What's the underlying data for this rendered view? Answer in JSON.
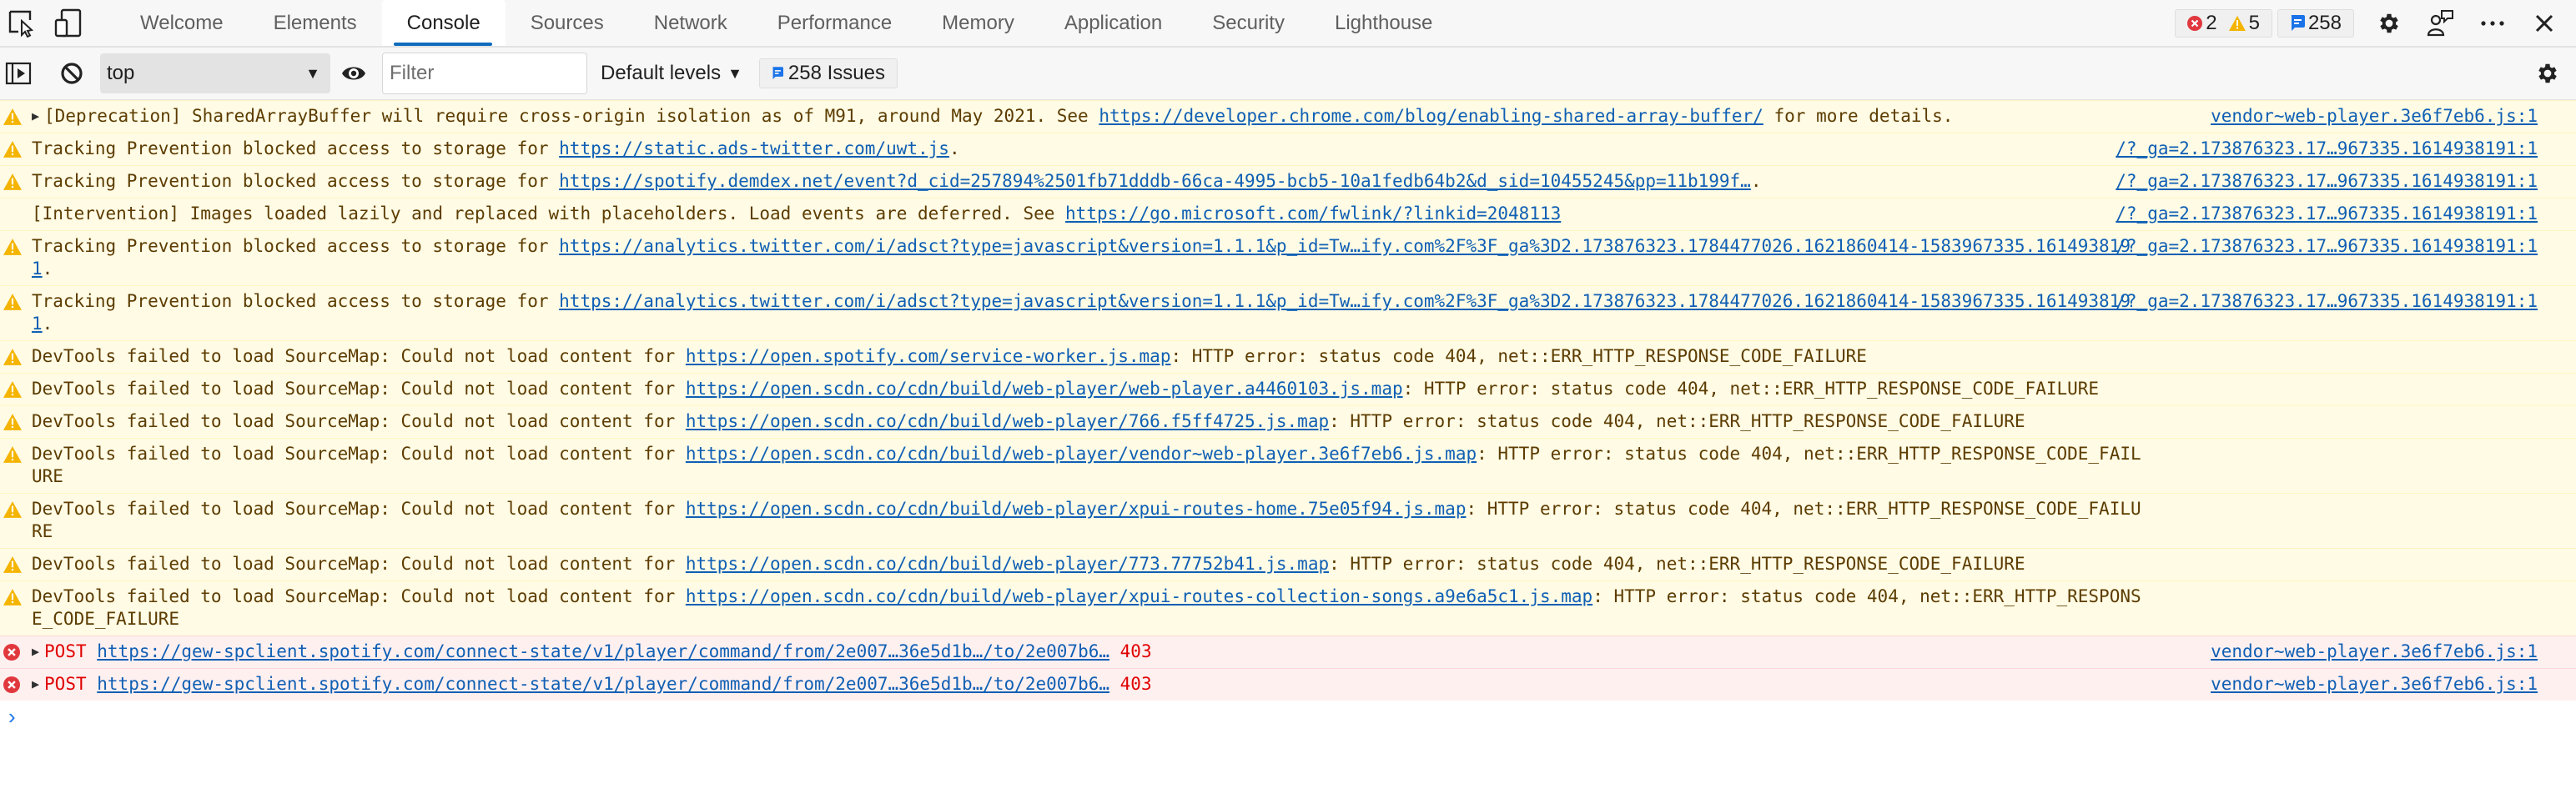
{
  "tabbar": {
    "left_icons": [
      "inspect-element-icon",
      "device-emulation-icon"
    ],
    "tabs": [
      {
        "label": "Welcome",
        "active": false
      },
      {
        "label": "Elements",
        "active": false
      },
      {
        "label": "Console",
        "active": true
      },
      {
        "label": "Sources",
        "active": false
      },
      {
        "label": "Network",
        "active": false
      },
      {
        "label": "Performance",
        "active": false
      },
      {
        "label": "Memory",
        "active": false
      },
      {
        "label": "Application",
        "active": false
      },
      {
        "label": "Security",
        "active": false
      },
      {
        "label": "Lighthouse",
        "active": false
      }
    ],
    "counters": {
      "errors": "2",
      "warnings": "5",
      "issues": "258"
    },
    "right_icons": [
      "settings-icon",
      "feedback-icon",
      "more-icon",
      "close-icon"
    ]
  },
  "console_toolbar": {
    "context": "top",
    "filter_placeholder": "Filter",
    "filter_value": "",
    "levels_label": "Default levels",
    "issues_label": "258 Issues"
  },
  "colors": {
    "accent": "#0f6cbd",
    "warning_bg": "#fffbe5",
    "warning_text": "#5c3c00",
    "error_bg": "#fff0f0",
    "error_text": "#e00000",
    "link": "#0f5fb4"
  },
  "messages": [
    {
      "level": "warning",
      "expandable": true,
      "parts": [
        {
          "t": "[Deprecation] SharedArrayBuffer will require cross-origin isolation as of M91, around May 2021. See "
        },
        {
          "link": "https://developer.chrome.com/blog/enabling-shared-array-buffer/"
        },
        {
          "t": " for more details."
        }
      ],
      "source": "vendor~web-player.3e6f7eb6.js:1"
    },
    {
      "level": "warning",
      "parts": [
        {
          "t": "Tracking Prevention blocked access to storage for "
        },
        {
          "link": "https://static.ads-twitter.com/uwt.js"
        },
        {
          "t": "."
        }
      ],
      "source": "/?_ga=2.173876323.17…967335.1614938191:1"
    },
    {
      "level": "warning",
      "parts": [
        {
          "t": "Tracking Prevention blocked access to storage for "
        },
        {
          "link": "https://spotify.demdex.net/event?d_cid=257894%2501fb71dddb-66ca-4995-bcb5-10a1fedb64b2&d_sid=10455245&pp=11b199f…"
        },
        {
          "t": "."
        }
      ],
      "source": "/?_ga=2.173876323.17…967335.1614938191:1"
    },
    {
      "level": "info",
      "parts": [
        {
          "t": "[Intervention] Images loaded lazily and replaced with placeholders. Load events are deferred. See "
        },
        {
          "link": "https://go.microsoft.com/fwlink/?linkid=2048113"
        }
      ],
      "source": "/?_ga=2.173876323.17…967335.1614938191:1"
    },
    {
      "level": "warning",
      "parts": [
        {
          "t": "Tracking Prevention blocked access to storage for "
        },
        {
          "link": "https://analytics.twitter.com/i/adsct?type=javascript&version=1.1.1&p_id=Tw…ify.com%2F%3F_ga%3D2.173876323.1784477026.1621860414-1583967335.1614938191"
        },
        {
          "t": "."
        }
      ],
      "source": "/?_ga=2.173876323.17…967335.1614938191:1"
    },
    {
      "level": "warning",
      "parts": [
        {
          "t": "Tracking Prevention blocked access to storage for "
        },
        {
          "link": "https://analytics.twitter.com/i/adsct?type=javascript&version=1.1.1&p_id=Tw…ify.com%2F%3F_ga%3D2.173876323.1784477026.1621860414-1583967335.1614938191"
        },
        {
          "t": "."
        }
      ],
      "source": "/?_ga=2.173876323.17…967335.1614938191:1"
    },
    {
      "level": "warning",
      "parts": [
        {
          "t": "DevTools failed to load SourceMap: Could not load content for "
        },
        {
          "link": "https://open.spotify.com/service-worker.js.map"
        },
        {
          "t": ": HTTP error: status code 404, net::ERR_HTTP_RESPONSE_CODE_FAILURE"
        }
      ]
    },
    {
      "level": "warning",
      "parts": [
        {
          "t": "DevTools failed to load SourceMap: Could not load content for "
        },
        {
          "link": "https://open.scdn.co/cdn/build/web-player/web-player.a4460103.js.map"
        },
        {
          "t": ": HTTP error: status code 404, net::ERR_HTTP_RESPONSE_CODE_FAILURE"
        }
      ]
    },
    {
      "level": "warning",
      "parts": [
        {
          "t": "DevTools failed to load SourceMap: Could not load content for "
        },
        {
          "link": "https://open.scdn.co/cdn/build/web-player/766.f5ff4725.js.map"
        },
        {
          "t": ": HTTP error: status code 404, net::ERR_HTTP_RESPONSE_CODE_FAILURE"
        }
      ]
    },
    {
      "level": "warning",
      "parts": [
        {
          "t": "DevTools failed to load SourceMap: Could not load content for "
        },
        {
          "link": "https://open.scdn.co/cdn/build/web-player/vendor~web-player.3e6f7eb6.js.map"
        },
        {
          "t": ": HTTP error: status code 404, net::ERR_HTTP_RESPONSE_CODE_FAILURE"
        }
      ]
    },
    {
      "level": "warning",
      "parts": [
        {
          "t": "DevTools failed to load SourceMap: Could not load content for "
        },
        {
          "link": "https://open.scdn.co/cdn/build/web-player/xpui-routes-home.75e05f94.js.map"
        },
        {
          "t": ": HTTP error: status code 404, net::ERR_HTTP_RESPONSE_CODE_FAILURE"
        }
      ]
    },
    {
      "level": "warning",
      "parts": [
        {
          "t": "DevTools failed to load SourceMap: Could not load content for "
        },
        {
          "link": "https://open.scdn.co/cdn/build/web-player/773.77752b41.js.map"
        },
        {
          "t": ": HTTP error: status code 404, net::ERR_HTTP_RESPONSE_CODE_FAILURE"
        }
      ]
    },
    {
      "level": "warning",
      "parts": [
        {
          "t": "DevTools failed to load SourceMap: Could not load content for "
        },
        {
          "link": "https://open.scdn.co/cdn/build/web-player/xpui-routes-collection-songs.a9e6a5c1.js.map"
        },
        {
          "t": ": HTTP error: status code 404, net::ERR_HTTP_RESPONSE_CODE_FAILURE"
        }
      ]
    },
    {
      "level": "error",
      "expandable": true,
      "method": "POST",
      "parts": [
        {
          "link": "https://gew-spclient.spotify.com/connect-state/v1/player/command/from/2e007…36e5d1b…/to/2e007b6…"
        },
        {
          "status": "403"
        }
      ],
      "source": "vendor~web-player.3e6f7eb6.js:1"
    },
    {
      "level": "error",
      "expandable": true,
      "method": "POST",
      "parts": [
        {
          "link": "https://gew-spclient.spotify.com/connect-state/v1/player/command/from/2e007…36e5d1b…/to/2e007b6…"
        },
        {
          "status": "403"
        }
      ],
      "source": "vendor~web-player.3e6f7eb6.js:1"
    }
  ],
  "prompt": {
    "symbol": "›"
  }
}
